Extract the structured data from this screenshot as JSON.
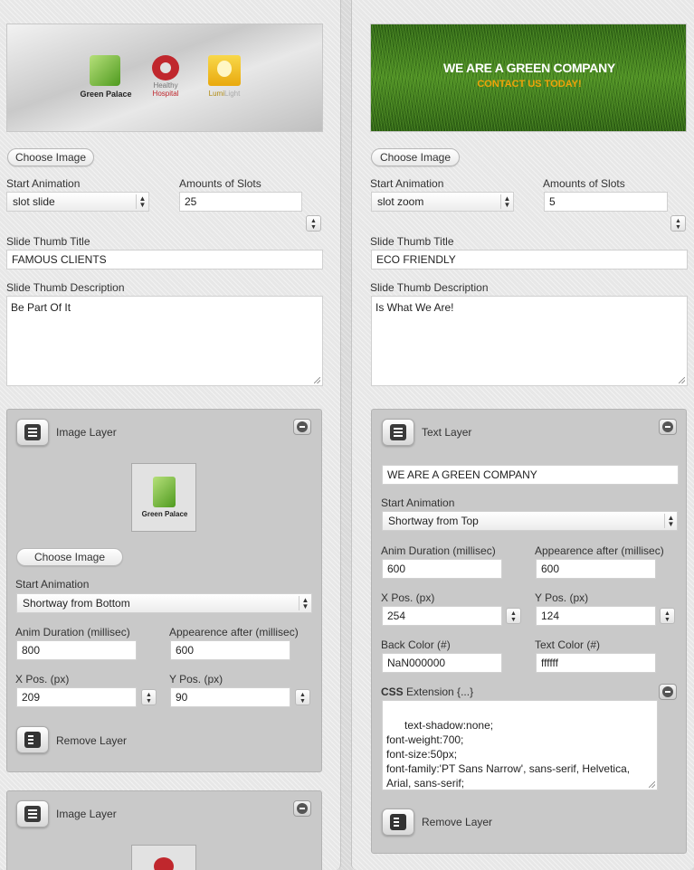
{
  "left": {
    "preview": {
      "logos": [
        {
          "name": "Green Palace"
        },
        {
          "name_line1": "Healthy",
          "name_line2": "Hospital"
        },
        {
          "name_part1": "Lumi",
          "name_part2": "Light"
        }
      ]
    },
    "choose_image": "Choose Image",
    "start_animation_label": "Start Animation",
    "start_animation_value": "slot slide",
    "slots_label": "Amounts of Slots",
    "slots_value": "25",
    "thumb_title_label": "Slide Thumb Title",
    "thumb_title_value": "FAMOUS CLIENTS",
    "thumb_desc_label": "Slide Thumb Description",
    "thumb_desc_value": "Be Part Of It",
    "layer1": {
      "title": "Image Layer",
      "thumb_text": "Green Palace",
      "choose_image": "Choose Image",
      "start_animation_label": "Start Animation",
      "start_animation_value": "Shortway from Bottom",
      "duration_label": "Anim Duration (millisec)",
      "duration_value": "800",
      "after_label": "Appearence after (millisec)",
      "after_value": "600",
      "xpos_label": "X Pos. (px)",
      "xpos_value": "209",
      "ypos_label": "Y Pos. (px)",
      "ypos_value": "90",
      "remove": "Remove Layer"
    },
    "layer2": {
      "title": "Image Layer"
    }
  },
  "right": {
    "preview": {
      "headline": "WE ARE A GREEN COMPANY",
      "subline": "CONTACT US TODAY!"
    },
    "choose_image": "Choose Image",
    "start_animation_label": "Start Animation",
    "start_animation_value": "slot zoom",
    "slots_label": "Amounts of Slots",
    "slots_value": "5",
    "thumb_title_label": "Slide Thumb Title",
    "thumb_title_value": "ECO FRIENDLY",
    "thumb_desc_label": "Slide Thumb Description",
    "thumb_desc_value": "Is What We Are!",
    "layer1": {
      "title": "Text Layer",
      "text_value": "WE ARE A GREEN COMPANY",
      "start_animation_label": "Start Animation",
      "start_animation_value": "Shortway from Top",
      "duration_label": "Anim Duration (millisec)",
      "duration_value": "600",
      "after_label": "Appearence after (millisec)",
      "after_value": "600",
      "xpos_label": "X Pos. (px)",
      "xpos_value": "254",
      "ypos_label": "Y Pos. (px)",
      "ypos_value": "124",
      "backcolor_label": "Back Color (#)",
      "backcolor_value": "NaN000000",
      "textcolor_label": "Text Color (#)",
      "textcolor_value": "ffffff",
      "css_label_bold": "CSS",
      "css_label_rest": " Extension {...}",
      "css_value": "text-shadow:none;\nfont-weight:700;\nfont-size:50px;\nfont-family:'PT Sans Narrow', sans-serif, Helvetica, Arial, sans-serif;",
      "remove": "Remove Layer"
    }
  },
  "colors": {
    "green_logo": "#7cc242",
    "hospital_red": "#c0272d",
    "lumi_yellow": "#f5c518",
    "grass": "#3f7a1e",
    "contact_orange": "#f0a30a"
  }
}
